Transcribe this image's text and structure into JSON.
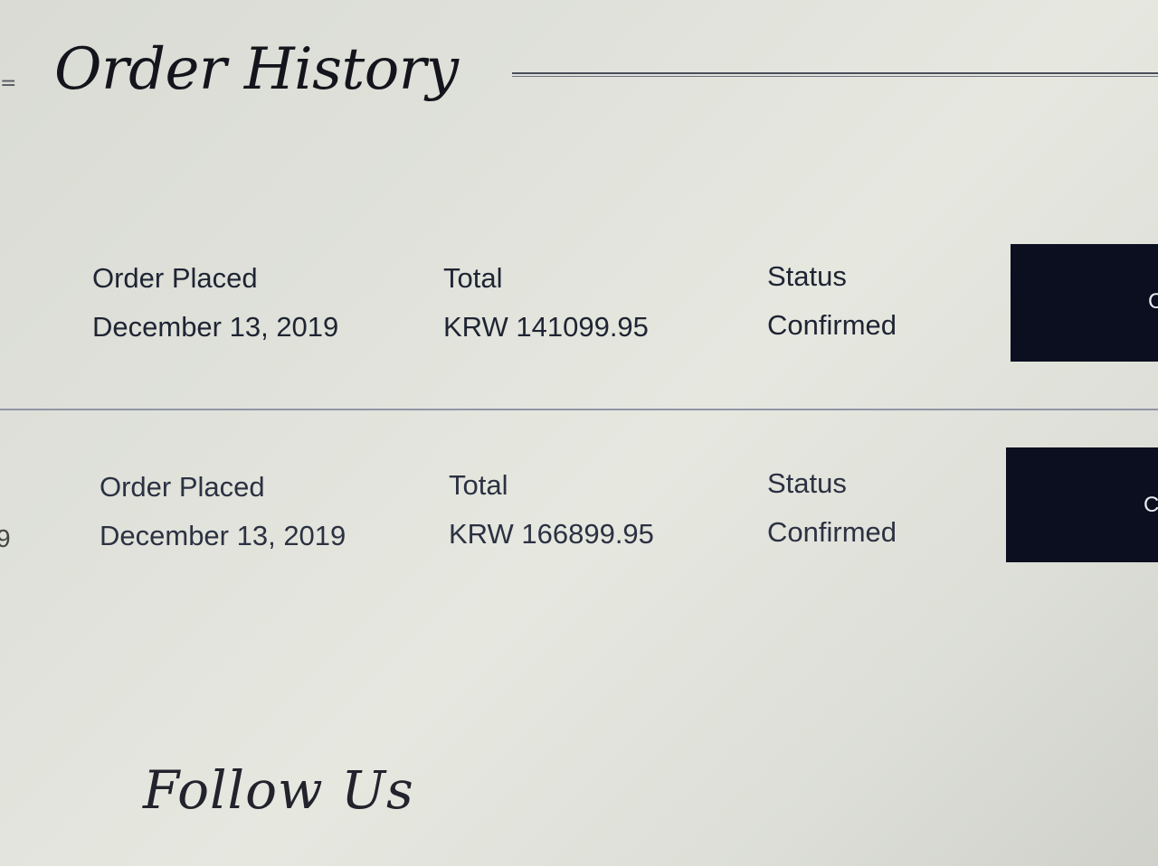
{
  "header": {
    "title": "Order History"
  },
  "orders": [
    {
      "placed_label": "Order Placed",
      "placed_date": "December 13, 2019",
      "total_label": "Total",
      "total_value": "KRW 141099.95",
      "status_label": "Status",
      "status_value": "Confirmed",
      "button_label": "C"
    },
    {
      "placed_label": "Order Placed",
      "placed_date": "December 13, 2019",
      "total_label": "Total",
      "total_value": "KRW 166899.95",
      "status_label": "Status",
      "status_value": "Confirmed",
      "button_label": "C"
    }
  ],
  "edge": {
    "menu_glyph": "=",
    "digit": "9"
  },
  "footer": {
    "follow_title": "Follow Us"
  },
  "colors": {
    "button_bg": "#0c0f1f",
    "text": "#1d2230",
    "divider": "#8f96a6"
  }
}
